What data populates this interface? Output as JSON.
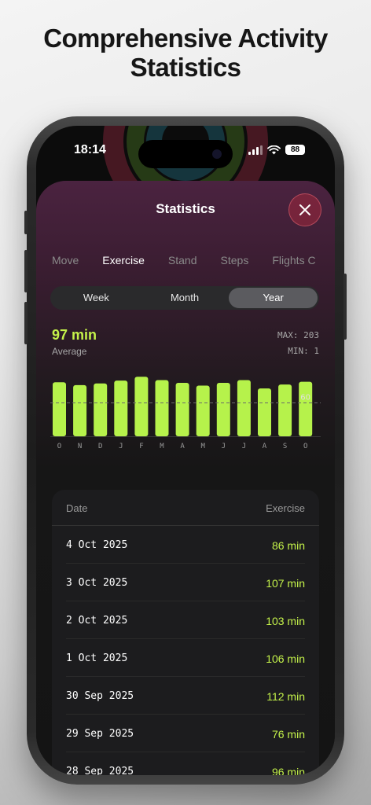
{
  "headline": {
    "line1": "Comprehensive Activity",
    "line2": "Statistics"
  },
  "status_bar": {
    "time": "18:14",
    "battery": "88"
  },
  "sheet": {
    "title": "Statistics"
  },
  "tabs": [
    {
      "label": "Move",
      "active": false
    },
    {
      "label": "Exercise",
      "active": true
    },
    {
      "label": "Stand",
      "active": false
    },
    {
      "label": "Steps",
      "active": false
    },
    {
      "label": "Flights C",
      "active": false
    }
  ],
  "range_selector": {
    "options": [
      "Week",
      "Month",
      "Year"
    ],
    "selected": "Year"
  },
  "summary": {
    "average_value": "97 min",
    "average_label": "Average",
    "max": "MAX: 203",
    "min": "MIN: 1"
  },
  "chart_data": {
    "type": "bar",
    "categories": [
      "O",
      "N",
      "D",
      "J",
      "F",
      "M",
      "A",
      "M",
      "J",
      "J",
      "A",
      "S",
      "O"
    ],
    "values": [
      97,
      92,
      95,
      100,
      107,
      101,
      96,
      91,
      96,
      101,
      86,
      93,
      98
    ],
    "reference_line": {
      "value": 60,
      "label": "60"
    },
    "ylim": [
      0,
      120
    ],
    "color": "#b6f24b"
  },
  "table": {
    "headers": {
      "date": "Date",
      "value": "Exercise"
    },
    "rows": [
      {
        "date": "4 Oct 2025",
        "value": "86 min"
      },
      {
        "date": "3 Oct 2025",
        "value": "107 min"
      },
      {
        "date": "2 Oct 2025",
        "value": "103 min"
      },
      {
        "date": "1 Oct 2025",
        "value": "106 min"
      },
      {
        "date": "30 Sep 2025",
        "value": "112 min"
      },
      {
        "date": "29 Sep 2025",
        "value": "76 min"
      },
      {
        "date": "28 Sep 2025",
        "value": "96 min"
      }
    ]
  },
  "colors": {
    "accent": "#c4f24a",
    "bar": "#b6f24b",
    "close_button": "#a0283c"
  }
}
